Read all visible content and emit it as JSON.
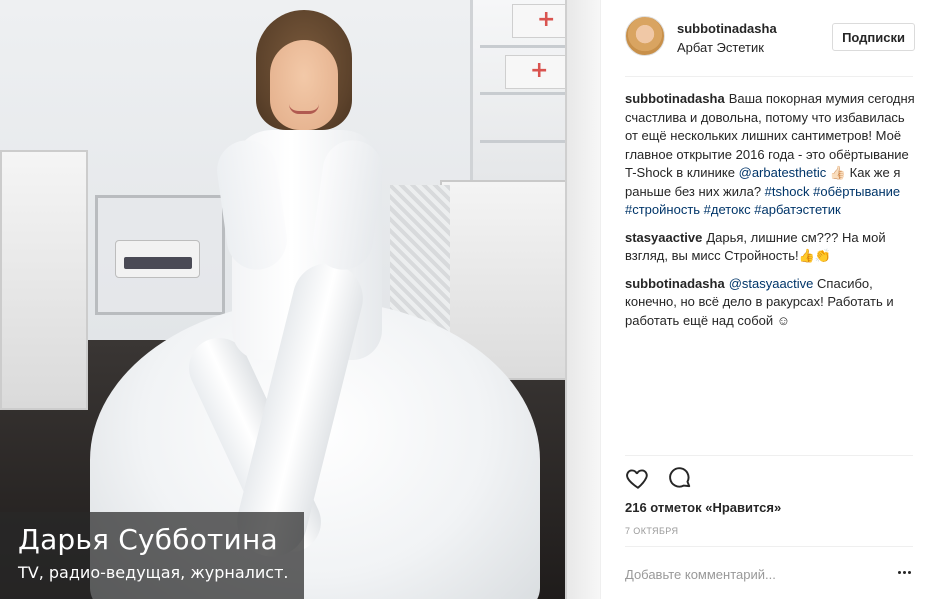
{
  "photo": {
    "caption_name": "Дарья Субботина",
    "caption_subtitle": "TV, радио-ведущая, журналист."
  },
  "header": {
    "username": "subbotinadasha",
    "location": "Арбат Эстетик",
    "follow_label": "Подписки"
  },
  "comments": [
    {
      "user": "subbotinadasha",
      "text_1": "Ваша покорная мумия сегодня счастлива и довольна, потому что избавилась от ещё нескольких лишних сантиметров! Моё главное открытие 2016 года - это обёртывание T-Shock в клинике ",
      "mention": "@arbatesthetic",
      "text_2": " 👍🏻 Как же я раньше без них жила? ",
      "hashtags": [
        "#tshock",
        "#обёртывание",
        "#стройность",
        "#детокс",
        "#арбатэстетик"
      ]
    },
    {
      "user": "stasyaactive",
      "text": "Дарья, лишние см??? На мой взгляд, вы мисс Стройность!👍👏"
    },
    {
      "user": "subbotinadasha",
      "mention": "@stasyaactive",
      "text": " Спасибо, конечно, но всё дело в ракурсах! Работать и работать ещё над собой ☺"
    }
  ],
  "icons": {
    "like": "heart-icon",
    "comment": "comment-bubble-icon",
    "more": "more-options-icon"
  },
  "likes": "216 отметок «Нравится»",
  "date": "7 октября",
  "add_comment": {
    "placeholder": "Добавьте комментарий..."
  },
  "colors": {
    "link": "#003569",
    "text": "#262626",
    "muted": "#999999",
    "border": "#dbdbdb"
  }
}
